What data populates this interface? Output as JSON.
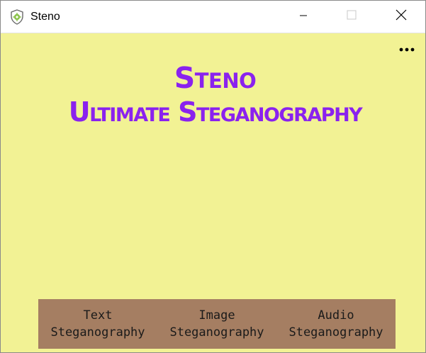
{
  "window": {
    "title": "Steno"
  },
  "heading": {
    "line1": "Steno",
    "line2": "Ultimate Steganography"
  },
  "menu": {
    "more_glyph": "•••"
  },
  "nav": [
    {
      "line1": "Text",
      "line2": "Steganography"
    },
    {
      "line1": "Image",
      "line2": "Steganography"
    },
    {
      "line1": "Audio",
      "line2": "Steganography"
    }
  ],
  "colors": {
    "background": "#f2f294",
    "heading": "#8a22ee",
    "nav_bar": "#a57e62",
    "nav_text": "#1a1a1a"
  },
  "icons": {
    "app": "shield-gear-icon",
    "minimize": "minimize-icon",
    "maximize": "maximize-icon",
    "close": "close-icon",
    "more": "more-horizontal-icon"
  }
}
